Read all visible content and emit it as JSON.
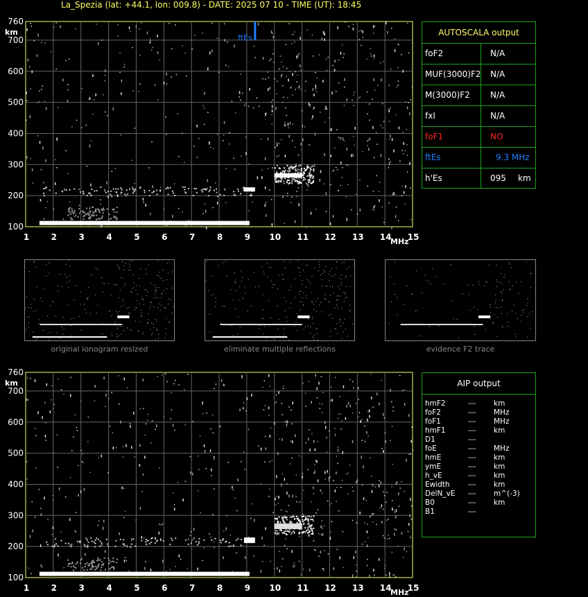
{
  "header": "La_Spezia (lat: +44.1, lon: 009.8) - DATE: 2025 07 10 - TIME (UT): 18:45",
  "colors": {
    "accent_yellow": "#ffff66",
    "panel_green": "#1fa31f",
    "blue": "#1f7fff",
    "red": "#ff2020",
    "white": "#ffffff"
  },
  "chart_data": [
    {
      "type": "scatter",
      "title": "",
      "xlabel": "MHz",
      "ylabel": "km",
      "xlim": [
        1,
        15
      ],
      "ylim": [
        100,
        760
      ],
      "x_ticks": [
        "1",
        "2",
        "3",
        "4",
        "5",
        "6",
        "7",
        "8",
        "9",
        "10",
        "11",
        "12",
        "13",
        "14",
        "15"
      ],
      "y_ticks": [
        "100",
        "200",
        "300",
        "400",
        "500",
        "600",
        "700",
        "760"
      ],
      "grid": true,
      "annotation": {
        "label": "ftEs",
        "x": 9.3
      },
      "traces": [
        {
          "name": "",
          "x_start": 1.5,
          "x_end": 9.1,
          "height_km": 112
        },
        {
          "name": "",
          "x_start": 8.9,
          "x_end": 9.3,
          "height_km": 220
        },
        {
          "name": "",
          "x_start": 10.0,
          "x_end": 11.0,
          "height_km": 265
        }
      ]
    },
    {
      "type": "scatter",
      "title": "",
      "xlabel": "MHz",
      "ylabel": "km",
      "xlim": [
        1,
        15
      ],
      "ylim": [
        100,
        760
      ],
      "x_ticks": [
        "1",
        "2",
        "3",
        "4",
        "5",
        "6",
        "7",
        "8",
        "9",
        "10",
        "11",
        "12",
        "13",
        "14",
        "15"
      ],
      "y_ticks": [
        "100",
        "200",
        "300",
        "400",
        "500",
        "600",
        "700",
        "760"
      ],
      "grid": true
    }
  ],
  "autoscala": {
    "title": "AUTOSCALA output",
    "rows": [
      {
        "label": "foF2",
        "value": "N/A",
        "color": "#ffffff"
      },
      {
        "label": "MUF(3000)F2",
        "value": "N/A",
        "color": "#ffffff"
      },
      {
        "label": "M(3000)F2",
        "value": "N/A",
        "color": "#ffffff"
      },
      {
        "label": "fxI",
        "value": "N/A",
        "color": "#ffffff"
      },
      {
        "label": "foF1",
        "value": "NO",
        "color": "#ff2020"
      },
      {
        "label": "ftEs",
        "value": "9.3 MHz",
        "color": "#1f7fff"
      },
      {
        "label": "h'Es",
        "value": "095",
        "unit": "km",
        "color": "#ffffff"
      }
    ]
  },
  "thumbnails": [
    {
      "caption": "original ionogram resized"
    },
    {
      "caption": "eliminate multiple reflections"
    },
    {
      "caption": "evidence F2 trace"
    }
  ],
  "aip": {
    "title": "AIP output",
    "rows": [
      {
        "name": "hmF2",
        "value": "---",
        "unit": "km"
      },
      {
        "name": "foF2",
        "value": "---",
        "unit": "MHz"
      },
      {
        "name": "foF1",
        "value": "---",
        "unit": "MHz"
      },
      {
        "name": "hmF1",
        "value": "---",
        "unit": "km"
      },
      {
        "name": "D1",
        "value": "---",
        "unit": ""
      },
      {
        "name": "foE",
        "value": "---",
        "unit": "MHz"
      },
      {
        "name": "hmE",
        "value": "---",
        "unit": "km"
      },
      {
        "name": "ymE",
        "value": "---",
        "unit": "km"
      },
      {
        "name": "h_vE",
        "value": "---",
        "unit": "km"
      },
      {
        "name": "Ewidth",
        "value": "---",
        "unit": "km"
      },
      {
        "name": "DelN_vE",
        "value": "---",
        "unit": "m^(-3)"
      },
      {
        "name": "B0",
        "value": "---",
        "unit": "km"
      },
      {
        "name": "B1",
        "value": "---",
        "unit": ""
      }
    ]
  }
}
